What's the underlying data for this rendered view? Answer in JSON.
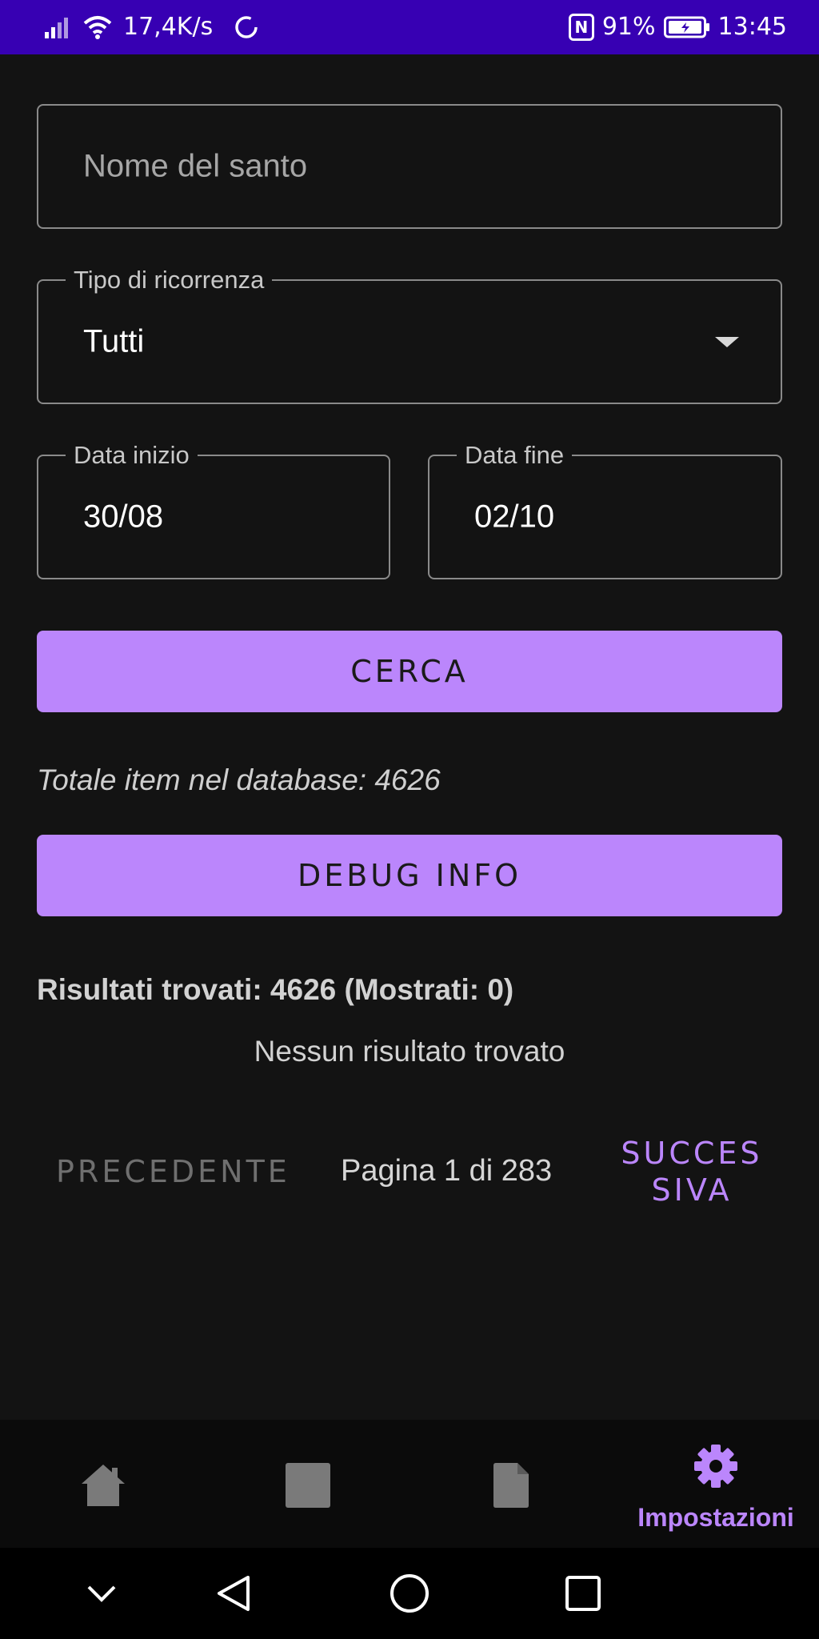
{
  "status_bar": {
    "network_speed": "17,4K/s",
    "battery_percent": "91%",
    "time": "13:45",
    "nfc_letter": "N"
  },
  "form": {
    "saint_name": {
      "placeholder": "Nome del santo",
      "value": ""
    },
    "recurrence_type": {
      "label": "Tipo di ricorrenza",
      "value": "Tutti"
    },
    "start_date": {
      "label": "Data inizio",
      "value": "30/08"
    },
    "end_date": {
      "label": "Data fine",
      "value": "02/10"
    },
    "search_button": "CERCA"
  },
  "info": {
    "total_items": "Totale item nel database: 4626",
    "debug_button": "DEBUG INFO",
    "results_summary": "Risultati trovati: 4626 (Mostrati: 0)",
    "no_results": "Nessun risultato trovato"
  },
  "pagination": {
    "previous": "PRECEDENTE",
    "page_info": "Pagina 1 di 283",
    "next_line1": "SUCCES",
    "next_line2": "SIVA"
  },
  "bottom_nav": {
    "items": [
      {
        "icon": "home-icon"
      },
      {
        "icon": "square-icon"
      },
      {
        "icon": "document-icon"
      },
      {
        "icon": "gear-icon",
        "label": "Impostazioni",
        "active": true
      }
    ]
  },
  "colors": {
    "accent": "#bb86fc",
    "status_bar": "#3700b3",
    "background": "#131313"
  }
}
